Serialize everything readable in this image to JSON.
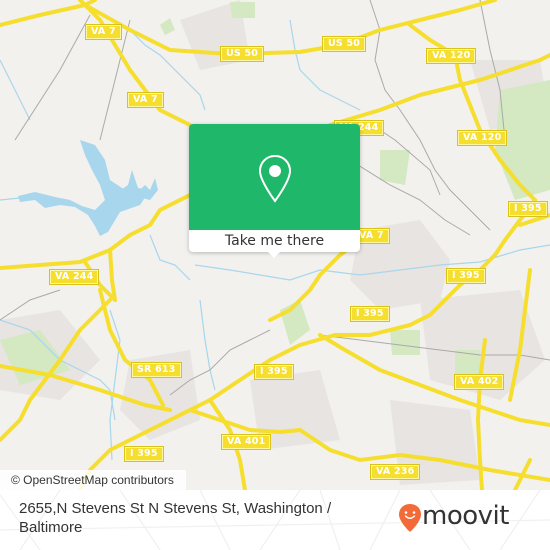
{
  "map": {
    "colors": {
      "background": "#f2f1ee",
      "water": "#a8d6ec",
      "park": "#d4e8c2",
      "urban": "#e8e4e1",
      "road": "#f6de2e",
      "minor_road": "#aaaaaa"
    },
    "road_labels": [
      {
        "id": "va7-top",
        "text": "VA 7"
      },
      {
        "id": "us50-left",
        "text": "US 50"
      },
      {
        "id": "us50-right",
        "text": "US 50"
      },
      {
        "id": "va120-top",
        "text": "VA 120"
      },
      {
        "id": "va7-mid",
        "text": "VA 7"
      },
      {
        "id": "va244-top",
        "text": "VA 244"
      },
      {
        "id": "va120-right",
        "text": "VA 120"
      },
      {
        "id": "i395-right",
        "text": "I 395"
      },
      {
        "id": "va244-left",
        "text": "VA 244"
      },
      {
        "id": "va7-center",
        "text": "VA 7"
      },
      {
        "id": "i395-mid",
        "text": "I 395"
      },
      {
        "id": "i395-center",
        "text": "I 395"
      },
      {
        "id": "sr613",
        "text": "SR 613"
      },
      {
        "id": "va402",
        "text": "VA 402"
      },
      {
        "id": "i395-left",
        "text": "I 395"
      },
      {
        "id": "va401",
        "text": "VA 401"
      },
      {
        "id": "i395-bottom",
        "text": "I 395"
      },
      {
        "id": "va236",
        "text": "VA 236"
      }
    ],
    "attribution": "© OpenStreetMap contributors"
  },
  "popup": {
    "button_label": "Take me there",
    "accent_color": "#1fb86a",
    "icon": "location-pin-icon"
  },
  "footer": {
    "address": "2655,N Stevens St N Stevens St, Washington / Baltimore",
    "brand": "moovit",
    "brand_color": "#f26a37"
  }
}
